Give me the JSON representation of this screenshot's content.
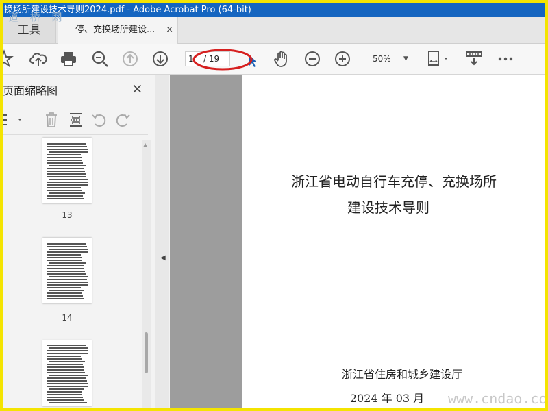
{
  "window": {
    "title": "换场所建设技术导则2024.pdf - Adobe Acrobat Pro (64-bit)",
    "watermark_top": "道 桥 网"
  },
  "tabs": {
    "tools_label": "工具",
    "document_label": "停、充换场所建设...",
    "close_glyph": "×"
  },
  "toolbar": {
    "current_page": "1",
    "page_total": "/ 19",
    "zoom": "50%"
  },
  "sidebar": {
    "title": "页面缩略图",
    "close_glyph": "×",
    "thumbnails": [
      {
        "page": "13"
      },
      {
        "page": "14"
      }
    ]
  },
  "document": {
    "title_line1": "浙江省电动自行车充停、充换场所",
    "title_line2": "建设技术导则",
    "author": "浙江省住房和城乡建设厅",
    "date": "2024 年 03 月"
  },
  "watermark_bottom": "www.cndao.com",
  "colors": {
    "title_bar": "#1565c0",
    "frame_border": "#f4e400",
    "annotation": "#d62020"
  },
  "icons": {
    "toolbar": [
      "star-icon",
      "cloud-upload-icon",
      "print-icon",
      "zoom-search-icon",
      "page-up-icon",
      "page-down-icon",
      "cursor-icon",
      "hand-icon",
      "zoom-out-icon",
      "zoom-in-icon",
      "fit-page-icon",
      "scroll-mode-icon",
      "more-icon"
    ],
    "sidebar": [
      "options-menu-icon",
      "delete-icon",
      "insert-page-icon",
      "rotate-left-icon",
      "rotate-right-icon"
    ]
  }
}
